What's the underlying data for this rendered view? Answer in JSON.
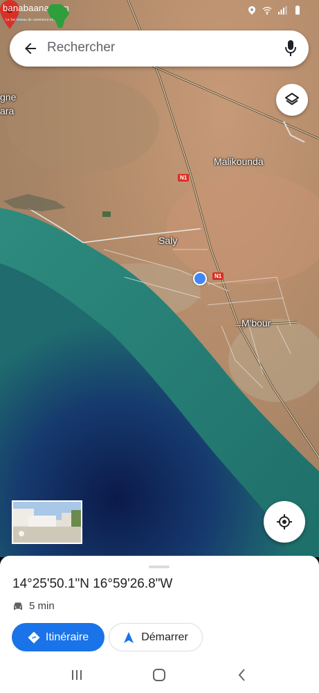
{
  "watermark": {
    "brand": "banabaana.com",
    "tagline": "Le 1er réseau de commerce en Afrique"
  },
  "search": {
    "placeholder": "Rechercher"
  },
  "map": {
    "labels": {
      "partial_left_1": "gne",
      "partial_left_2": "ara",
      "malikounda": "Malikounda",
      "saly": "Saly",
      "mbour": "M'bour"
    },
    "road_badges": [
      "N1",
      "N1"
    ]
  },
  "place": {
    "coordinates": "14°25'50.1\"N 16°59'26.8\"W",
    "travel_time": "5 min"
  },
  "actions": {
    "directions_label": "Itinéraire",
    "start_label": "Démarrer"
  },
  "colors": {
    "accent": "#1a73e8",
    "pin": "#d93025",
    "my_location": "#4285f4"
  },
  "icons": [
    "back-arrow-icon",
    "mic-icon",
    "layers-icon",
    "locate-icon",
    "car-icon",
    "directions-icon",
    "navigation-arrow-icon",
    "recents-icon",
    "home-icon",
    "back-icon"
  ]
}
